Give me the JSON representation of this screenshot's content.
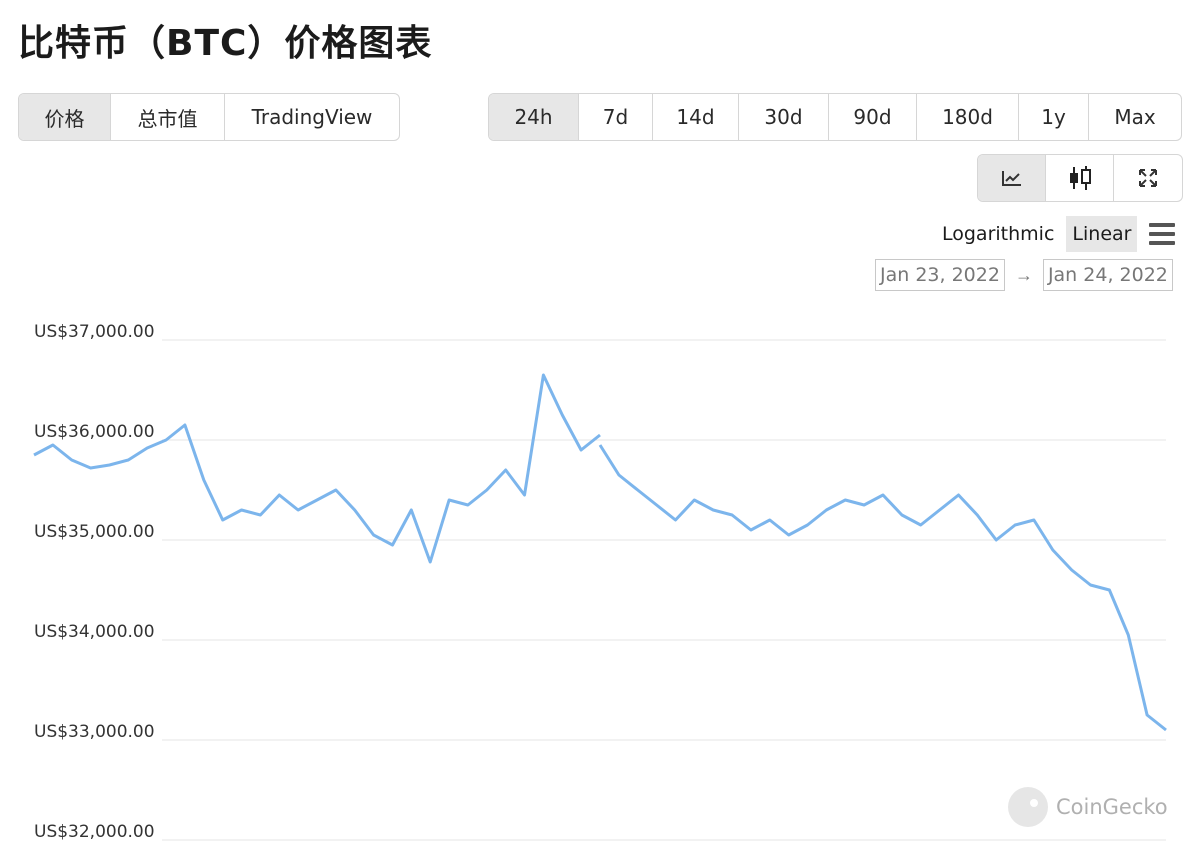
{
  "header": {
    "title": "比特币（BTC）价格图表"
  },
  "tabs": [
    {
      "label": "价格",
      "active": true
    },
    {
      "label": "总市值",
      "active": false
    },
    {
      "label": "TradingView",
      "active": false
    }
  ],
  "ranges": [
    {
      "label": "24h",
      "active": true
    },
    {
      "label": "7d",
      "active": false
    },
    {
      "label": "14d",
      "active": false
    },
    {
      "label": "30d",
      "active": false
    },
    {
      "label": "90d",
      "active": false
    },
    {
      "label": "180d",
      "active": false
    },
    {
      "label": "1y",
      "active": false
    },
    {
      "label": "Max",
      "active": false
    }
  ],
  "tools": [
    {
      "icon": "line-chart-icon",
      "active": true
    },
    {
      "icon": "candlestick-icon",
      "active": false
    },
    {
      "icon": "fullscreen-icon",
      "active": false
    }
  ],
  "scale": {
    "log_label": "Logarithmic",
    "linear_label": "Linear",
    "selected": "Linear"
  },
  "date_range": {
    "from": "Jan 23, 2022",
    "arrow": "→",
    "to": "Jan 24, 2022"
  },
  "watermark": {
    "text": "CoinGecko"
  },
  "colors": {
    "line": "#7cb5ec",
    "grid": "#e6e6e6",
    "active_button": "#e7e7e7"
  },
  "chart_data": {
    "type": "line",
    "title": "",
    "xlabel": "",
    "ylabel": "",
    "ylim": [
      32000,
      37000
    ],
    "yticks": [
      37000,
      36000,
      35000,
      34000,
      33000,
      32000
    ],
    "ytick_labels": [
      "US$37,000.00",
      "US$36,000.00",
      "US$35,000.00",
      "US$34,000.00",
      "US$33,000.00",
      "US$32,000.00"
    ],
    "x": [
      0,
      0.8,
      1.6,
      2.4,
      3.2,
      4,
      4.8,
      5.6,
      6.4,
      7.2,
      8,
      8.8,
      9.6,
      10.4,
      11.2,
      12,
      12.8,
      13.6,
      14.4,
      15.2,
      16,
      16.8,
      17.6,
      18.4,
      19.2,
      20,
      20.8,
      21.6,
      22.4,
      23.2,
      24
    ],
    "series": [
      {
        "values": [
          35850,
          35950,
          35800,
          35720,
          35750,
          35800,
          35920,
          36000,
          36150,
          35600,
          35200,
          35300,
          35250,
          35450,
          35300,
          35400,
          35500,
          35300,
          35050,
          34950,
          35300,
          34780,
          35400,
          35350,
          35500,
          35700,
          35450,
          36650,
          36250,
          35900,
          36050
        ]
      },
      {
        "values": [
          35950,
          35650,
          35500,
          35350,
          35200,
          35400,
          35300,
          35250,
          35100,
          35200,
          35050,
          35150,
          35300,
          35400,
          35350,
          35450,
          35250,
          35150,
          35300,
          35450,
          35250,
          35000,
          35150,
          35200,
          34900,
          34700,
          34550,
          34500,
          34050,
          33250,
          33100
        ]
      }
    ]
  }
}
